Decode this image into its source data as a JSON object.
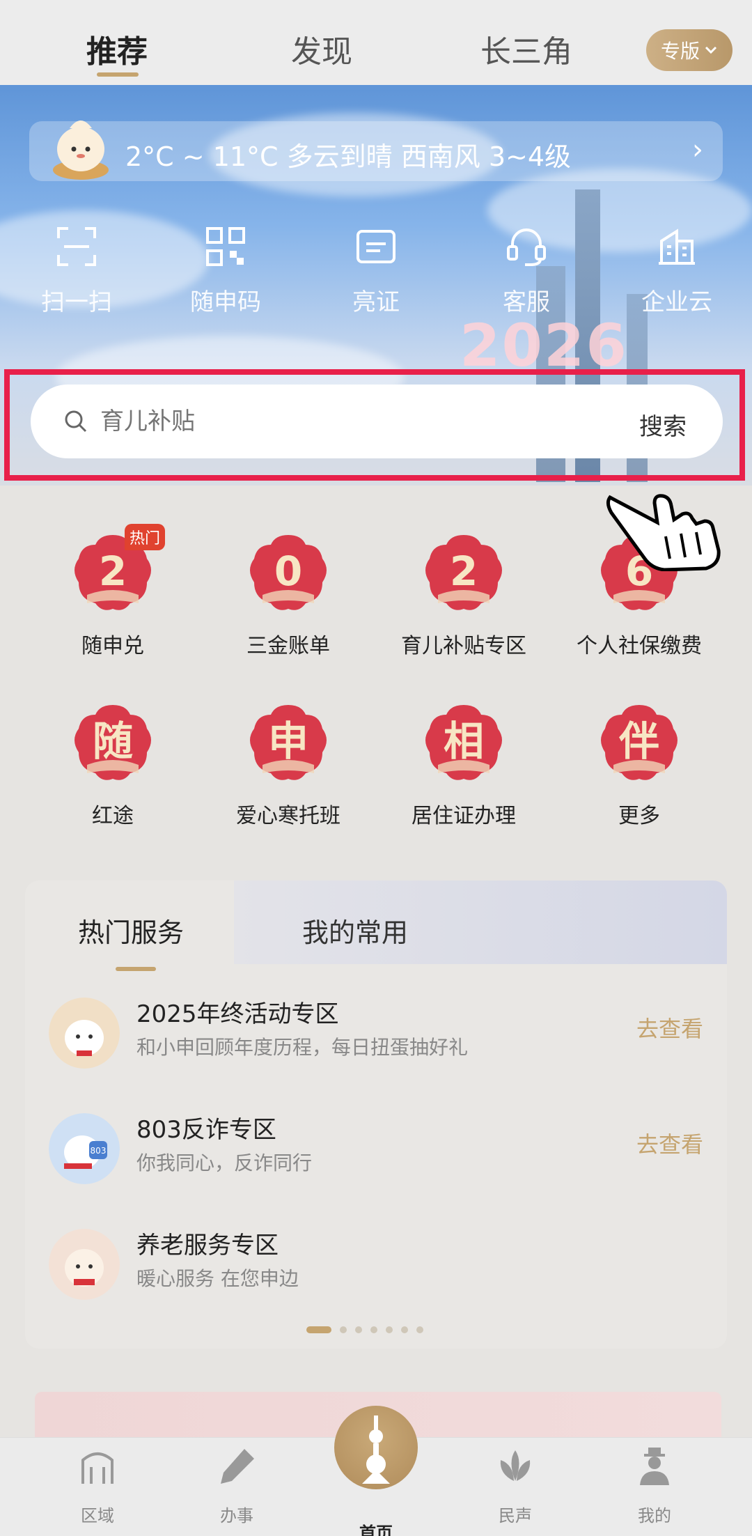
{
  "top_tabs": [
    {
      "label": "推荐",
      "active": true
    },
    {
      "label": "发现",
      "active": false
    },
    {
      "label": "长三角",
      "active": false
    }
  ],
  "pro_button": "专版",
  "weather": {
    "text": "2°C ~ 11°C  多云到晴  西南风  3~4级"
  },
  "quick_actions": [
    {
      "label": "扫一扫",
      "icon": "scan-icon"
    },
    {
      "label": "随申码",
      "icon": "qr-code-icon"
    },
    {
      "label": "亮证",
      "icon": "id-card-icon"
    },
    {
      "label": "客服",
      "icon": "headset-icon"
    },
    {
      "label": "企业云",
      "icon": "building-icon"
    }
  ],
  "hero_year": "2026",
  "search": {
    "placeholder": "育儿补贴",
    "button": "搜索"
  },
  "services": [
    {
      "label": "随申兑",
      "glyph": "2",
      "tag": "热门"
    },
    {
      "label": "三金账单",
      "glyph": "0",
      "tag": ""
    },
    {
      "label": "育儿补贴专区",
      "glyph": "2",
      "tag": ""
    },
    {
      "label": "个人社保缴费",
      "glyph": "6",
      "tag": ""
    },
    {
      "label": "红途",
      "glyph": "随",
      "tag": ""
    },
    {
      "label": "爱心寒托班",
      "glyph": "申",
      "tag": ""
    },
    {
      "label": "居住证办理",
      "glyph": "相",
      "tag": ""
    },
    {
      "label": "更多",
      "glyph": "伴",
      "tag": ""
    }
  ],
  "hot_card": {
    "tabs": [
      {
        "label": "热门服务",
        "active": true
      },
      {
        "label": "我的常用",
        "active": false
      }
    ],
    "items": [
      {
        "title": "2025年终活动专区",
        "subtitle": "和小申回顾年度历程，每日扭蛋抽好礼",
        "action": "去查看"
      },
      {
        "title": "803反诈专区",
        "subtitle": "你我同心，反诈同行",
        "action": "去查看"
      },
      {
        "title": "养老服务专区",
        "subtitle": "暖心服务 在您申边",
        "action": ""
      }
    ],
    "pager": {
      "total": 7,
      "active": 0
    }
  },
  "bottom_nav": [
    {
      "label": "区域",
      "icon": "region-icon",
      "active": false
    },
    {
      "label": "办事",
      "icon": "pen-icon",
      "active": false
    },
    {
      "label": "首页",
      "icon": "pearl-tower-icon",
      "active": true
    },
    {
      "label": "民声",
      "icon": "lotus-icon",
      "active": false
    },
    {
      "label": "我的",
      "icon": "profile-icon",
      "active": false
    }
  ],
  "colors": {
    "accent_gold": "#c5a46f",
    "highlight_red": "#e8204a",
    "flower_red": "#d83a4a"
  }
}
